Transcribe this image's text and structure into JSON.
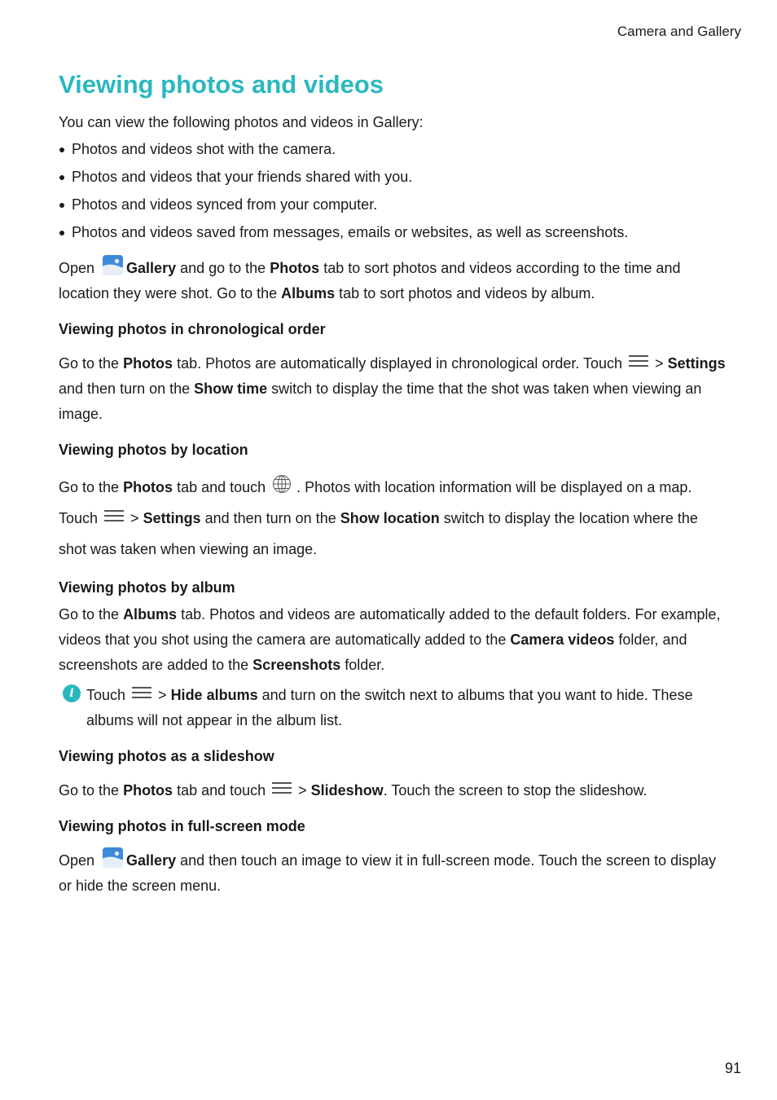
{
  "header": {
    "section": "Camera and Gallery"
  },
  "page_number": "91",
  "title": "Viewing photos and videos",
  "intro": "You can view the following photos and videos in Gallery:",
  "bullets": [
    "Photos and videos shot with the camera.",
    "Photos and videos that your friends shared with you.",
    "Photos and videos synced from your computer.",
    "Photos and videos saved from messages, emails or websites, as well as screenshots."
  ],
  "open_para": {
    "t1": "Open",
    "gallery": "Gallery",
    "t2": " and go to the ",
    "photos": "Photos",
    "t3": " tab to sort photos and videos according to the time and location they were shot. Go to the ",
    "albums": "Albums",
    "t4": " tab to sort photos and videos by album."
  },
  "sections": {
    "chronological": {
      "heading": "Viewing photos in chronological order",
      "t1": "Go to the ",
      "photos": "Photos",
      "t2": " tab. Photos are automatically displayed in chronological order. Touch",
      "t3": "> ",
      "settings": "Settings",
      "t4": " and then turn on the ",
      "show_time": "Show time",
      "t5": " switch to display the time that the shot was taken when viewing an image."
    },
    "location": {
      "heading": "Viewing photos by location",
      "t1": "Go to the ",
      "photos": "Photos",
      "t2": " tab and touch",
      "t3": ". Photos with location information will be displayed on a map. Touch",
      "t4": "> ",
      "settings": "Settings",
      "t5": " and then turn on the ",
      "show_location": "Show location",
      "t6": " switch to display the location where the shot was taken when viewing an image."
    },
    "album": {
      "heading": "Viewing photos by album",
      "t1": "Go to the ",
      "albums": "Albums",
      "t2": " tab. Photos and videos are automatically added to the default folders. For example, videos that you shot using the camera are automatically added to the ",
      "camera_videos": "Camera videos",
      "t3": " folder, and screenshots are added to the ",
      "screenshots": "Screenshots",
      "t4": " folder.",
      "note": {
        "icon_glyph": "i",
        "t1": "Touch",
        "t2": "> ",
        "hide_albums": "Hide albums",
        "t3": " and turn on the switch next to albums that you want to hide. These albums will not appear in the album list."
      }
    },
    "slideshow": {
      "heading": "Viewing photos as a slideshow",
      "t1": "Go to the ",
      "photos": "Photos",
      "t2": " tab and touch",
      "t3": "> ",
      "slideshow": "Slideshow",
      "t4": ". Touch the screen to stop the slideshow."
    },
    "fullscreen": {
      "heading": "Viewing photos in full-screen mode",
      "t1": "Open",
      "gallery": "Gallery",
      "t2": " and then touch an image to view it in full-screen mode. Touch the screen to display or hide the screen menu."
    }
  }
}
